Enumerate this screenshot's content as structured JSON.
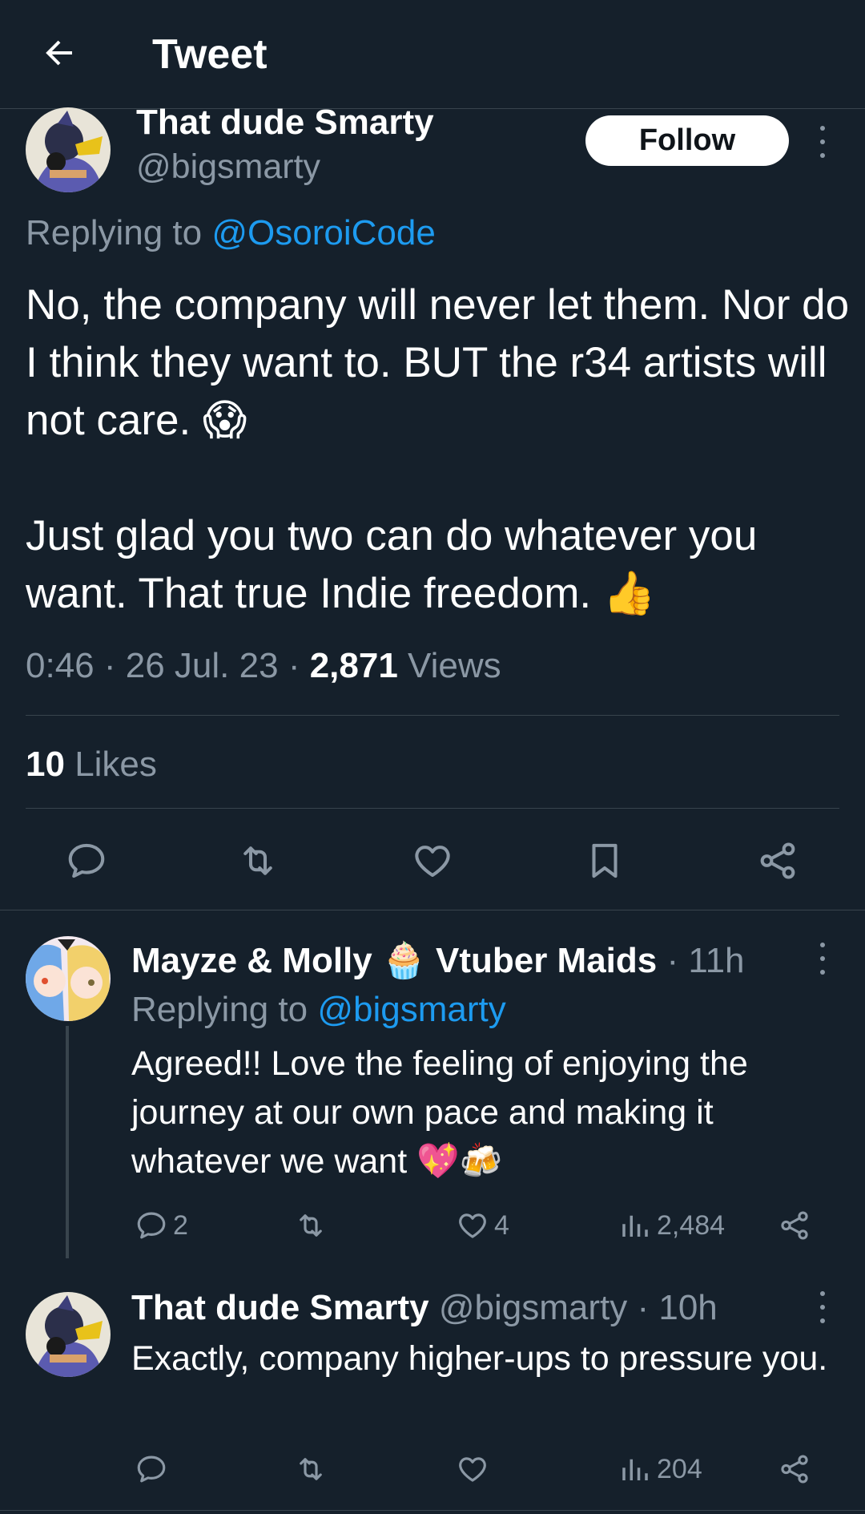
{
  "header": {
    "title": "Tweet"
  },
  "main_tweet": {
    "author_name": "That dude Smarty",
    "author_handle": "@bigsmarty",
    "follow_label": "Follow",
    "replying_prefix": "Replying to",
    "replying_to": "@OsoroiCode",
    "text": "No, the company will never let them. Nor do I think they want to. BUT the r34 artists will not care. 😱\n\nJust glad you two can do whatever you want. That true Indie freedom. 👍",
    "time": "0:46",
    "date": "26 Jul. 23",
    "views_count": "2,871",
    "views_label": "Views",
    "likes_count": "10",
    "likes_label": "Likes"
  },
  "replies": [
    {
      "author_name": "Mayze & Molly 🧁 Vtuber Maids",
      "time": "· 11h",
      "replying_prefix": "Replying to",
      "replying_to": "@bigsmarty",
      "text": "Agreed!! Love the feeling of enjoying the journey at our own pace and making it whatever we want 💖🍻",
      "reply_count": "2",
      "like_count": "4",
      "view_count": "2,484"
    },
    {
      "author_name": "That dude Smarty",
      "author_handle": "@bigsmarty",
      "time": "· 10h",
      "text": "Exactly, company higher-ups to pressure you.",
      "view_count": "204"
    }
  ],
  "colors": {
    "background": "#15202b",
    "divider": "#38444d",
    "secondary_text": "#8b98a5",
    "link": "#1d9bf0"
  },
  "icons": [
    "back-arrow-icon",
    "more-icon",
    "reply-icon",
    "retweet-icon",
    "like-icon",
    "bookmark-icon",
    "share-icon",
    "views-icon"
  ]
}
